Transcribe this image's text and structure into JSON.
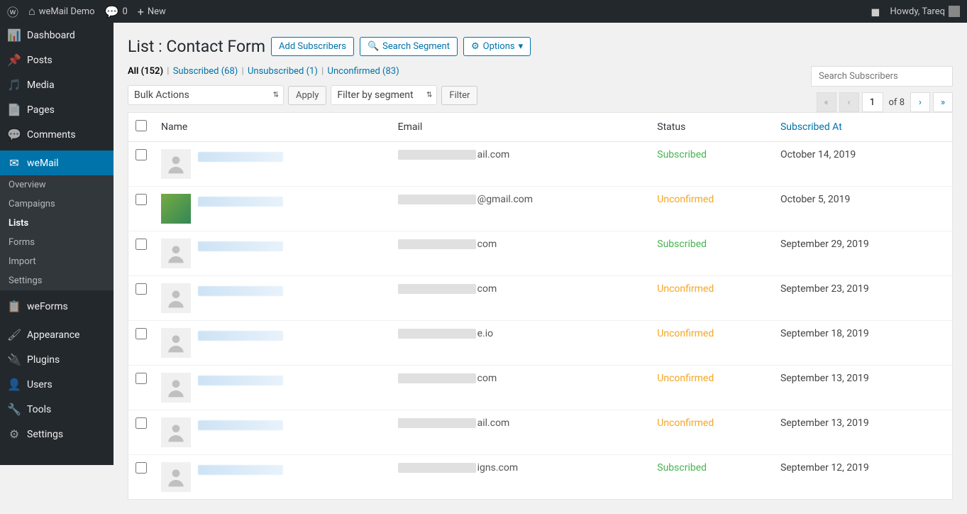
{
  "adminbar": {
    "site_name": "weMail Demo",
    "comments_count": "0",
    "new_label": "New",
    "howdy": "Howdy, Tareq"
  },
  "sidebar": {
    "items": [
      {
        "icon": "dashboard",
        "label": "Dashboard"
      },
      {
        "icon": "pin",
        "label": "Posts"
      },
      {
        "icon": "media",
        "label": "Media"
      },
      {
        "icon": "page",
        "label": "Pages"
      },
      {
        "icon": "comment",
        "label": "Comments"
      },
      {
        "icon": "mail",
        "label": "weMail",
        "active": true
      },
      {
        "icon": "form",
        "label": "weForms"
      },
      {
        "icon": "appearance",
        "label": "Appearance"
      },
      {
        "icon": "plugin",
        "label": "Plugins"
      },
      {
        "icon": "users",
        "label": "Users"
      },
      {
        "icon": "tools",
        "label": "Tools"
      },
      {
        "icon": "settings",
        "label": "Settings"
      }
    ],
    "submenu": [
      {
        "label": "Overview"
      },
      {
        "label": "Campaigns"
      },
      {
        "label": "Lists",
        "active": true
      },
      {
        "label": "Forms"
      },
      {
        "label": "Import"
      },
      {
        "label": "Settings"
      }
    ]
  },
  "header": {
    "title_prefix": "List :",
    "title_name": "Contact Form",
    "add_subscribers": "Add Subscribers",
    "search_segment": "Search Segment",
    "options": "Options"
  },
  "filters": {
    "all_label": "All",
    "all_count": "(152)",
    "subscribed_label": "Subscribed",
    "subscribed_count": "(68)",
    "unsubscribed_label": "Unsubscribed",
    "unsubscribed_count": "(1)",
    "unconfirmed_label": "Unconfirmed",
    "unconfirmed_count": "(83)"
  },
  "toolbar": {
    "bulk_actions": "Bulk Actions",
    "apply": "Apply",
    "filter_segment": "Filter by segment",
    "filter": "Filter",
    "search_placeholder": "Search Subscribers"
  },
  "pagination": {
    "current": "1",
    "of_label": "of",
    "total": "8"
  },
  "table": {
    "columns": {
      "name": "Name",
      "email": "Email",
      "status": "Status",
      "subscribed_at": "Subscribed At"
    },
    "rows": [
      {
        "avatar": "default",
        "email_frag": "ail.com",
        "status": "Subscribed",
        "date": "October 14, 2019"
      },
      {
        "avatar": "photo",
        "email_frag": "@gmail.com",
        "status": "Unconfirmed",
        "date": "October 5, 2019"
      },
      {
        "avatar": "default",
        "email_frag": "com",
        "status": "Subscribed",
        "date": "September 29, 2019"
      },
      {
        "avatar": "default",
        "email_frag": "com",
        "status": "Unconfirmed",
        "date": "September 23, 2019"
      },
      {
        "avatar": "default",
        "email_frag": "e.io",
        "status": "Unconfirmed",
        "date": "September 18, 2019"
      },
      {
        "avatar": "default",
        "email_frag": "com",
        "status": "Unconfirmed",
        "date": "September 13, 2019"
      },
      {
        "avatar": "default",
        "email_frag": "ail.com",
        "status": "Unconfirmed",
        "date": "September 13, 2019"
      },
      {
        "avatar": "default",
        "email_frag": "igns.com",
        "status": "Subscribed",
        "date": "September 12, 2019"
      }
    ]
  }
}
